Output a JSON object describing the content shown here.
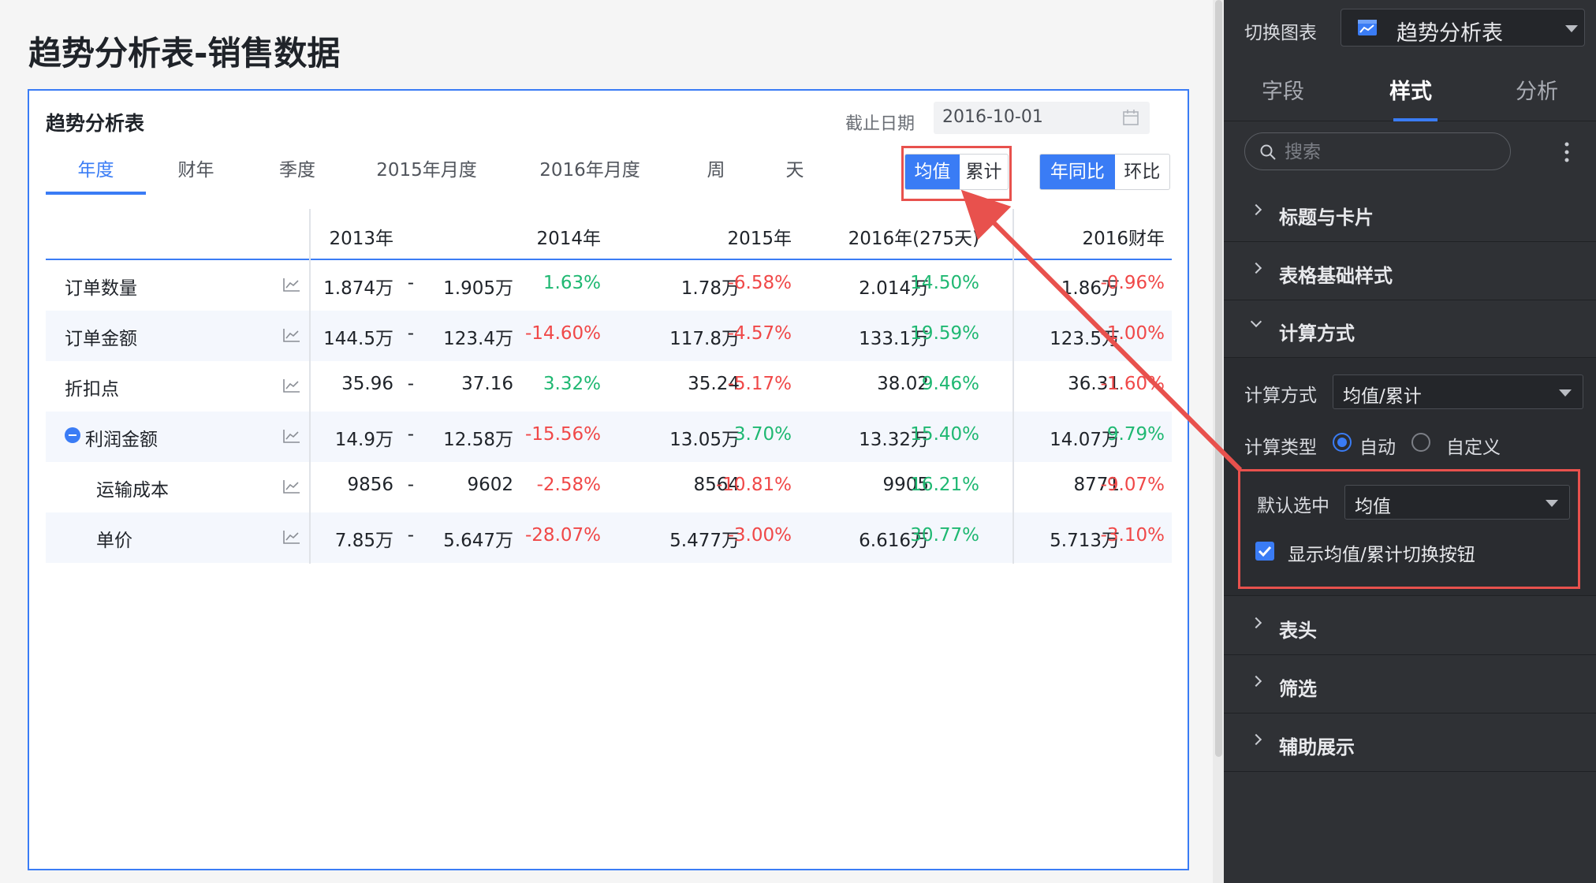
{
  "page_title": "趋势分析表-销售数据",
  "card": {
    "title": "趋势分析表",
    "date_label": "截止日期",
    "date_value": "2016-10-01"
  },
  "tabs": [
    "年度",
    "财年",
    "季度",
    "2015年月度",
    "2016年月度",
    "周",
    "天"
  ],
  "active_tab": "年度",
  "mode_toggle": {
    "selected": "均值",
    "other": "累计"
  },
  "compare_toggle": {
    "selected": "年同比",
    "other": "环比"
  },
  "table": {
    "columns": [
      "2013年",
      "2014年",
      "2015年",
      "2016年(275天)",
      "2016财年"
    ],
    "rows": [
      {
        "label": "订单数量",
        "values": [
          "1.874万",
          "1.905万",
          "1.78万",
          "2.014万",
          "1.86万"
        ],
        "pcts": [
          "-",
          "1.63%",
          "-6.58%",
          "14.50%",
          "-0.96%"
        ],
        "alt": false
      },
      {
        "label": "订单金额",
        "values": [
          "144.5万",
          "123.4万",
          "117.8万",
          "133.1万",
          "123.5万"
        ],
        "pcts": [
          "-",
          "-14.60%",
          "-4.57%",
          "19.59%",
          "-1.00%"
        ],
        "alt": true
      },
      {
        "label": "折扣点",
        "values": [
          "35.96",
          "37.16",
          "35.24",
          "38.02",
          "36.31"
        ],
        "pcts": [
          "-",
          "3.32%",
          "-5.17%",
          "9.46%",
          "-1.60%"
        ],
        "alt": false
      },
      {
        "label": "利润金额",
        "values": [
          "14.9万",
          "12.58万",
          "13.05万",
          "13.32万",
          "14.07万"
        ],
        "pcts": [
          "-",
          "-15.56%",
          "3.70%",
          "15.40%",
          "9.79%"
        ],
        "alt": true
      },
      {
        "label": "运输成本",
        "values": [
          "9856",
          "9602",
          "8564",
          "9905",
          "8771"
        ],
        "pcts": [
          "-",
          "-2.58%",
          "-10.81%",
          "16.21%",
          "-9.07%"
        ],
        "alt": false
      },
      {
        "label": "单价",
        "values": [
          "7.85万",
          "5.647万",
          "5.477万",
          "6.616万",
          "5.713万"
        ],
        "pcts": [
          "-",
          "-28.07%",
          "-3.00%",
          "30.77%",
          "-3.10%"
        ],
        "alt": true
      }
    ]
  },
  "panel": {
    "switch_label": "切换图表",
    "chart_select_value": "趋势分析表",
    "tabs": [
      "字段",
      "样式",
      "分析"
    ],
    "active_tab": "样式",
    "search_placeholder": "搜索",
    "sections_top": [
      "标题与卡片",
      "表格基础样式"
    ],
    "open_section": "计算方式",
    "calc_method_label": "计算方式",
    "calc_method_value": "均值/累计",
    "calc_type_label": "计算类型",
    "calc_type_options": [
      "自动",
      "自定义"
    ],
    "calc_type_selected": "自动",
    "default_label": "默认选中",
    "default_value": "均值",
    "checkbox_label": "显示均值/累计切换按钮",
    "checkbox_checked": true,
    "sections_bottom": [
      "表头",
      "筛选",
      "辅助展示"
    ]
  },
  "colors": {
    "accent": "#3a7cf5",
    "positive": "#1fb872",
    "negative": "#f04848",
    "highlight": "#e8514d"
  }
}
